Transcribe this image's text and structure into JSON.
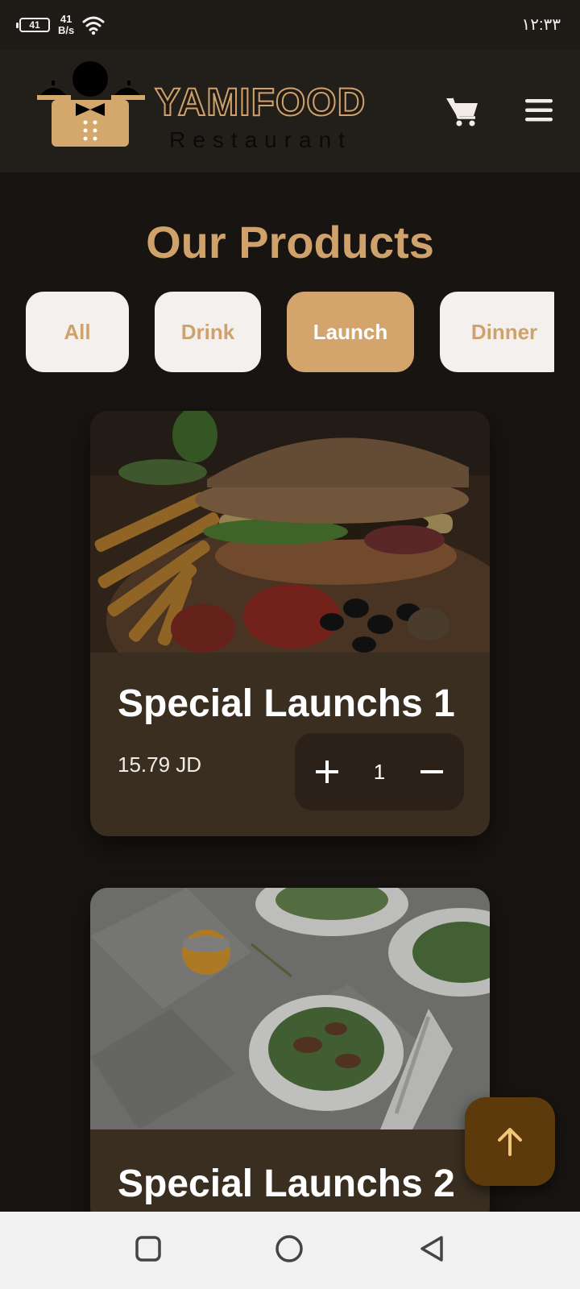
{
  "status": {
    "battery": "41",
    "net_speed_value": "41",
    "net_speed_unit": "B/s",
    "time": "۱۲:۳۳"
  },
  "header": {
    "brand": "YAMIFOOD",
    "brand_sub": "Restaurant",
    "cart_icon": "cart-icon",
    "menu_icon": "hamburger-menu-icon"
  },
  "page": {
    "title": "Our Products"
  },
  "filters": [
    {
      "label": "All",
      "active": false
    },
    {
      "label": "Drink",
      "active": false
    },
    {
      "label": "Launch",
      "active": true
    },
    {
      "label": "Dinner",
      "active": false
    }
  ],
  "products": [
    {
      "name": "Special Launchs 1",
      "price": "15.79 JD",
      "quantity": "1",
      "image": "burger-with-fries"
    },
    {
      "name": "Special Launchs 2",
      "price": "",
      "quantity": "",
      "image": "salad-plates"
    }
  ],
  "colors": {
    "accent": "#cfa26c",
    "active_filter": "#d3a46b",
    "card": "#3a2e21",
    "background": "#171411",
    "scroll_top": "#5c3a0b"
  }
}
